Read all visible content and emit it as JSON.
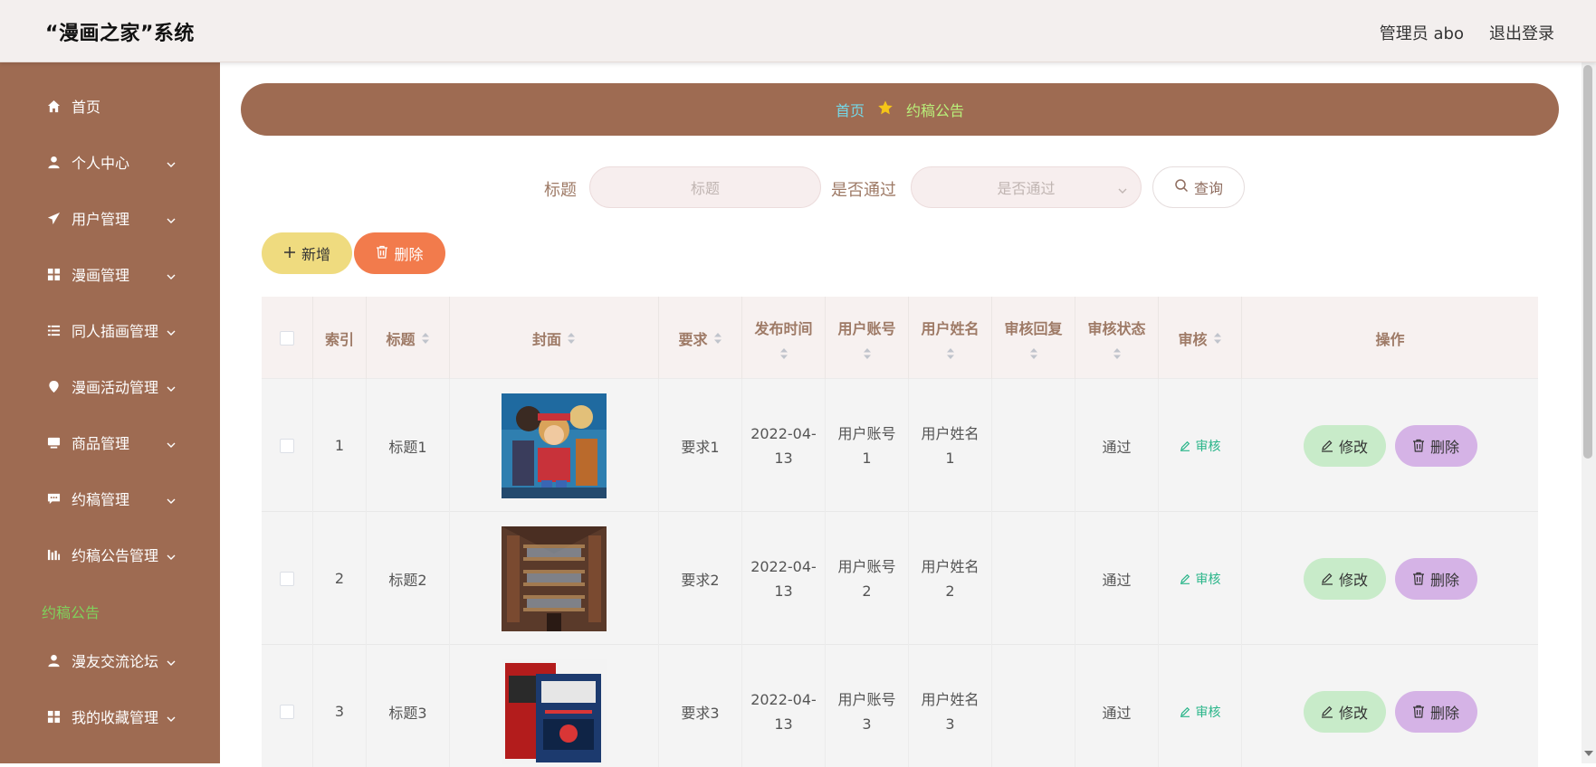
{
  "app": {
    "title": "“漫画之家”系统"
  },
  "header": {
    "user": "管理员 abo",
    "logout": "退出登录"
  },
  "sidebar": {
    "items": [
      {
        "label": "首页",
        "icon": "home-icon"
      },
      {
        "label": "个人中心",
        "icon": "user-icon"
      },
      {
        "label": "用户管理",
        "icon": "paper-plane-icon"
      },
      {
        "label": "漫画管理",
        "icon": "grid-icon"
      },
      {
        "label": "同人插画管理",
        "icon": "list-icon"
      },
      {
        "label": "漫画活动管理",
        "icon": "location-pin-icon"
      },
      {
        "label": "商品管理",
        "icon": "monitor-icon"
      },
      {
        "label": "约稿管理",
        "icon": "chat-icon"
      },
      {
        "label": "约稿公告管理",
        "icon": "bar-chart-icon"
      }
    ],
    "active_child": "约稿公告",
    "items_after": [
      {
        "label": "漫友交流论坛",
        "icon": "user-icon"
      },
      {
        "label": "我的收藏管理",
        "icon": "grid-icon"
      }
    ]
  },
  "breadcrumb": {
    "home": "首页",
    "current": "约稿公告"
  },
  "search": {
    "title_label": "标题",
    "title_placeholder": "标题",
    "pass_label": "是否通过",
    "pass_placeholder": "是否通过",
    "query_button": "查询"
  },
  "actions": {
    "add": "新增",
    "delete": "删除"
  },
  "table": {
    "headers": {
      "index": "索引",
      "title": "标题",
      "cover": "封面",
      "requirement": "要求",
      "publish_time": "发布时间",
      "user_account": "用户账号",
      "user_name": "用户姓名",
      "review_reply": "审核回复",
      "review_status": "审核状态",
      "review": "审核",
      "operation": "操作"
    },
    "rows": [
      {
        "index": "1",
        "title": "标题1",
        "requirement": "要求1",
        "date1": "2022-04-",
        "date2": "13",
        "acc1": "用户账号",
        "acc2": "1",
        "name1": "用户姓名",
        "name2": "1",
        "reply": "",
        "status": "通过",
        "review": "审核",
        "edit": "修改",
        "delete": "删除"
      },
      {
        "index": "2",
        "title": "标题2",
        "requirement": "要求2",
        "date1": "2022-04-",
        "date2": "13",
        "acc1": "用户账号",
        "acc2": "2",
        "name1": "用户姓名",
        "name2": "2",
        "reply": "",
        "status": "通过",
        "review": "审核",
        "edit": "修改",
        "delete": "删除"
      },
      {
        "index": "3",
        "title": "标题3",
        "requirement": "要求3",
        "date1": "2022-04-",
        "date2": "13",
        "acc1": "用户账号",
        "acc2": "3",
        "name1": "用户姓名",
        "name2": "3",
        "reply": "",
        "status": "通过",
        "review": "审核",
        "edit": "修改",
        "delete": "删除"
      }
    ]
  },
  "colors": {
    "sidebar_bg": "#9e6b52",
    "active_green": "#7fd15c",
    "add_button": "#efdb7f",
    "delete_button": "#f27b4c",
    "edit_button": "#c8ebc9",
    "row_delete_button": "#d5b3e6",
    "review_link": "#29b589"
  }
}
